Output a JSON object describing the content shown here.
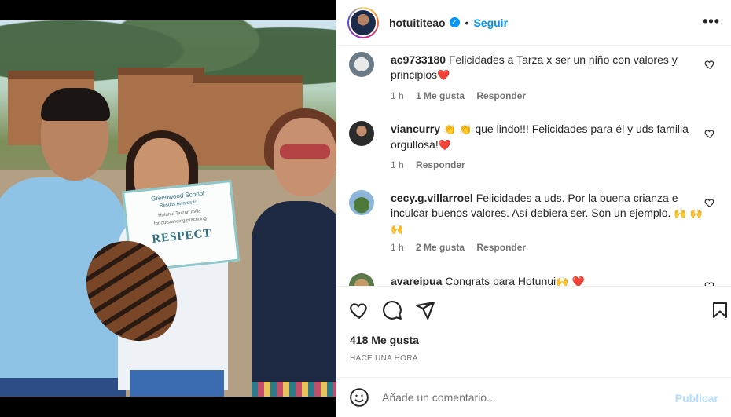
{
  "post": {
    "username": "hotuititeao",
    "verified": true,
    "follow_label": "Seguir",
    "more_label": "•••",
    "likes_label": "418 Me gusta",
    "time_label": "HACE UNA HORA"
  },
  "photo": {
    "certificate": {
      "school": "Greenwood School",
      "subtitle": "Results Awards to",
      "name": "Hotunui Tarzan Avila",
      "for_label": "for outstanding practicing",
      "value": "RESPECT"
    }
  },
  "comments": [
    {
      "username": "ac9733180",
      "text": "Felicidades a Tarza x ser un niño con valores y principios",
      "emoji": "❤️",
      "time": "1 h",
      "likes": "1 Me gusta",
      "reply": "Responder"
    },
    {
      "username": "viancurry",
      "text_prefix": "👏 👏",
      "text": "que lindo!!! Felicidades para él y uds familia orgullosa!",
      "emoji": "❤️",
      "time": "1 h",
      "likes": "",
      "reply": "Responder"
    },
    {
      "username": "cecy.g.villarroel",
      "text": "Felicidades a uds. Por la buena crianza e inculcar buenos valores. Así debiera ser. Son un ejemplo.",
      "emoji": "🙌 🙌 🙌",
      "time": "1 h",
      "likes": "2 Me gusta",
      "reply": "Responder"
    },
    {
      "username": "avareipua",
      "text": "Congrats para Hotunui",
      "emoji": "🙌 ❤️"
    }
  ],
  "comment_box": {
    "placeholder": "Añade un comentario...",
    "publish_label": "Publicar"
  },
  "colors": {
    "accent": "#0095f6",
    "publish_disabled": "#b3dbff",
    "heart": "#ed1d3a",
    "muted": "#737373"
  },
  "icons": [
    "verified-badge-icon",
    "more-options-icon",
    "heart-icon",
    "comment-icon",
    "share-icon",
    "bookmark-icon",
    "emoji-icon"
  ]
}
